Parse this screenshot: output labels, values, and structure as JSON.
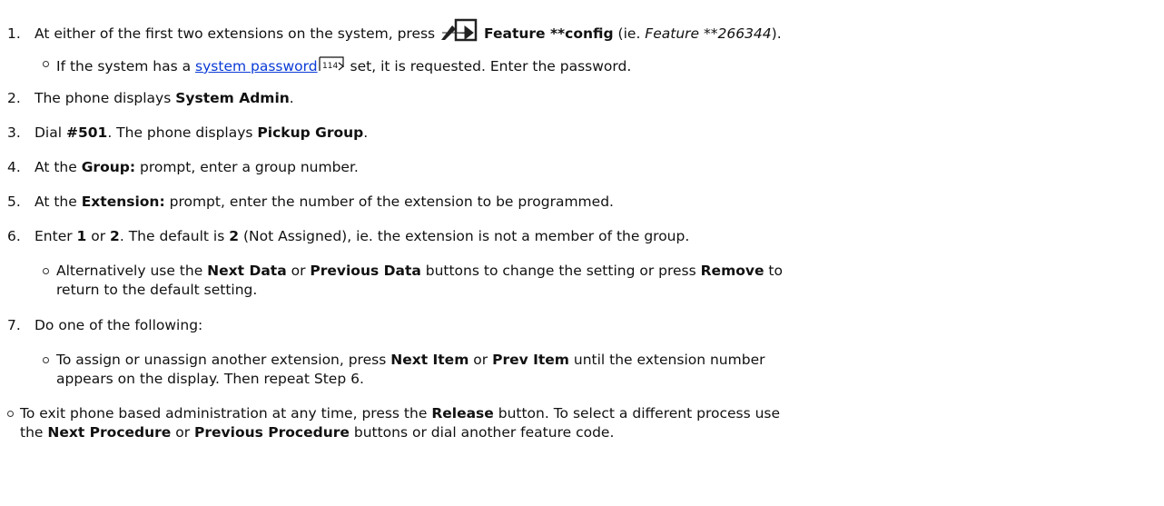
{
  "steps": [
    {
      "num": "1.",
      "pre": "At either of the first two extensions on the system, press ",
      "icon": "feature-arrow-icon",
      "bold": "Feature **config",
      "mid": " (ie. ",
      "italic": "Feature **266344",
      "post": ")."
    },
    {
      "pre": "If the system has a ",
      "link": "system password",
      "xref": "114",
      "post": " set, it is requested. Enter the password."
    },
    {
      "num": "2.",
      "pre": "The phone displays ",
      "bold": "System Admin",
      "post": "."
    },
    {
      "num": "3.",
      "pre": "Dial ",
      "bold": "#501",
      "mid": ". The phone displays ",
      "bold2": "Pickup Group",
      "post": "."
    },
    {
      "num": "4.",
      "pre": "At the ",
      "bold": "Group:",
      "post": " prompt, enter a group number."
    },
    {
      "num": "5.",
      "pre": "At the ",
      "bold": "Extension:",
      "post": " prompt, enter the number of the extension to be programmed."
    },
    {
      "num": "6.",
      "pre": "Enter ",
      "bold": "1",
      "mid": " or ",
      "bold2": "2",
      "mid2": ". The default is ",
      "bold3": "2",
      "post": " (Not Assigned), ie. the extension is not a member of the group."
    },
    {
      "pre": "Alternatively use the ",
      "bold": "Next Data",
      "mid": " or ",
      "bold2": "Previous Data",
      "mid2": " buttons to change the setting or press ",
      "bold3": "Remove",
      "post": " to",
      "cont": "return to the default setting."
    },
    {
      "num": "7.",
      "pre": "Do one of the following:"
    },
    {
      "pre": "To assign or unassign another extension, press ",
      "bold": "Next Item",
      "mid": " or ",
      "bold2": "Prev Item",
      "post": " until the extension number",
      "cont": "appears on the display. Then repeat Step 6."
    },
    {
      "pre": "To exit phone based administration at any time, press the ",
      "bold": "Release",
      "post": " button. To select a different process use",
      "cont_pre": "the ",
      "cont_bold": "Next Procedure",
      "cont_mid": " or ",
      "cont_bold2": "Previous Procedure",
      "cont_post": " buttons or dial another feature code."
    }
  ]
}
